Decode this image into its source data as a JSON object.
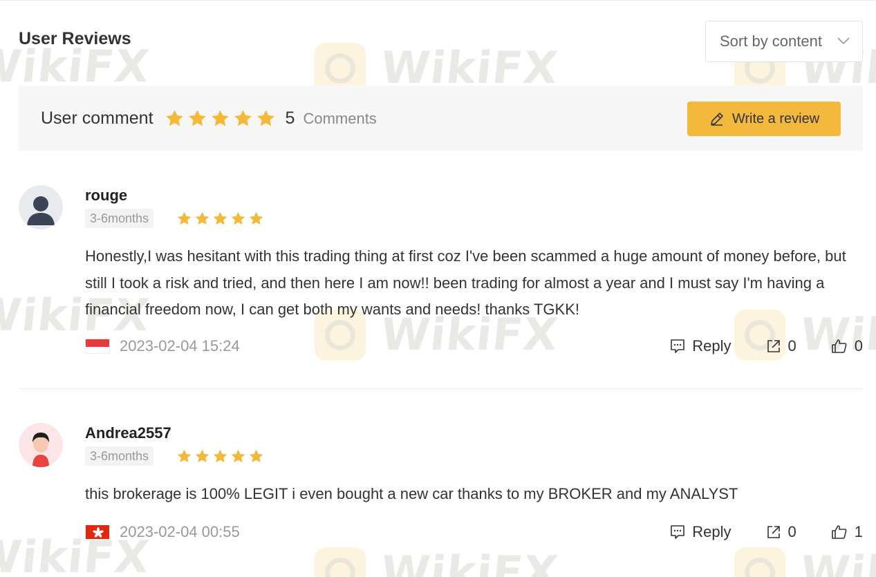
{
  "header": {
    "title": "User Reviews"
  },
  "sort": {
    "label": "Sort by content"
  },
  "summary": {
    "label": "User comment",
    "rating": 5,
    "count": "5",
    "count_label": "Comments",
    "write_label": "Write a review"
  },
  "watermark": {
    "text": "WikiFX"
  },
  "colors": {
    "star": "#f5b93a",
    "button": "#f2b93d"
  },
  "reviews": [
    {
      "username": "rouge",
      "duration": "3-6months",
      "rating": 5,
      "content": "Honestly,I was hesitant with this trading thing at first coz I've been scammed a huge amount of money before, but still I took a risk and tried, and then here I am now!! been trading for almost a year and I must say I'm having a financial freedom now, I can get both my wants and needs! thanks TGKK!",
      "flag": "singapore-flag",
      "date": "2023-02-04 15:24",
      "reply_label": "Reply",
      "shares": "0",
      "likes": "0"
    },
    {
      "username": "Andrea2557",
      "duration": "3-6months",
      "rating": 5,
      "content": "this brokerage is 100% LEGIT i even bought a new car thanks to my BROKER and my ANALYST",
      "flag": "hong-kong-flag",
      "date": "2023-02-04 00:55",
      "reply_label": "Reply",
      "shares": "0",
      "likes": "1"
    }
  ]
}
